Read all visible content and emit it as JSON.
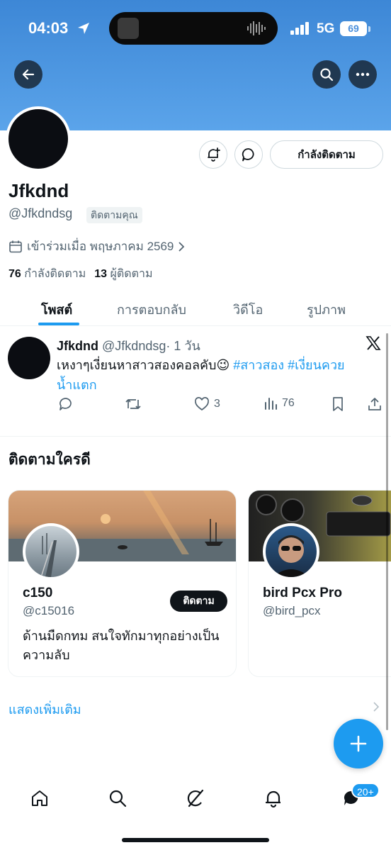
{
  "status_bar": {
    "time": "04:03",
    "network": "5G",
    "battery": "69"
  },
  "profile": {
    "display_name": "Jfkdnd",
    "handle": "@Jfkdndsg",
    "follows_you_badge": "ติดตามคุณ",
    "joined": "เข้าร่วมเมื่อ พฤษภาคม 2569",
    "following_count": "76",
    "following_label": "กำลังติดตาม",
    "followers_count": "13",
    "followers_label": "ผู้ติดตาม",
    "following_button": "กำลังติดตาม"
  },
  "tabs": [
    {
      "label": "โพสต์",
      "active": true
    },
    {
      "label": "การตอบกลับ",
      "active": false
    },
    {
      "label": "วิดีโอ",
      "active": false
    },
    {
      "label": "รูปภาพ",
      "active": false
    }
  ],
  "post": {
    "author": "Jfkdnd",
    "handle": "@Jfkdndsg",
    "time": "· 1 วัน",
    "text": "เหงาๆเงี่ยนหาสาวสองคอลคับ😉",
    "hashtag1": "#สาวสอง",
    "hashtag2": "#เงี่ยนควย",
    "hashtag2_cont": "น้ำแตก",
    "likes": "3",
    "views": "76"
  },
  "who_to_follow": {
    "title": "ติดตามใครดี",
    "cards": [
      {
        "name": "c150",
        "handle": "@c15016",
        "bio": "ด้านมืดกทม สนใจทักมาทุกอย่างเป็นความลับ",
        "follow_label": "ติดตาม"
      },
      {
        "name": "bird Pcx Pro",
        "handle": "@bird_pcx"
      }
    ],
    "show_more": "แสดงเพิ่มเติม"
  },
  "nav": {
    "messages_badge": "20+"
  },
  "colors": {
    "accent": "#1d9bf0",
    "banner": "#4b8fdc",
    "text": "#0f1419",
    "muted": "#536471"
  }
}
